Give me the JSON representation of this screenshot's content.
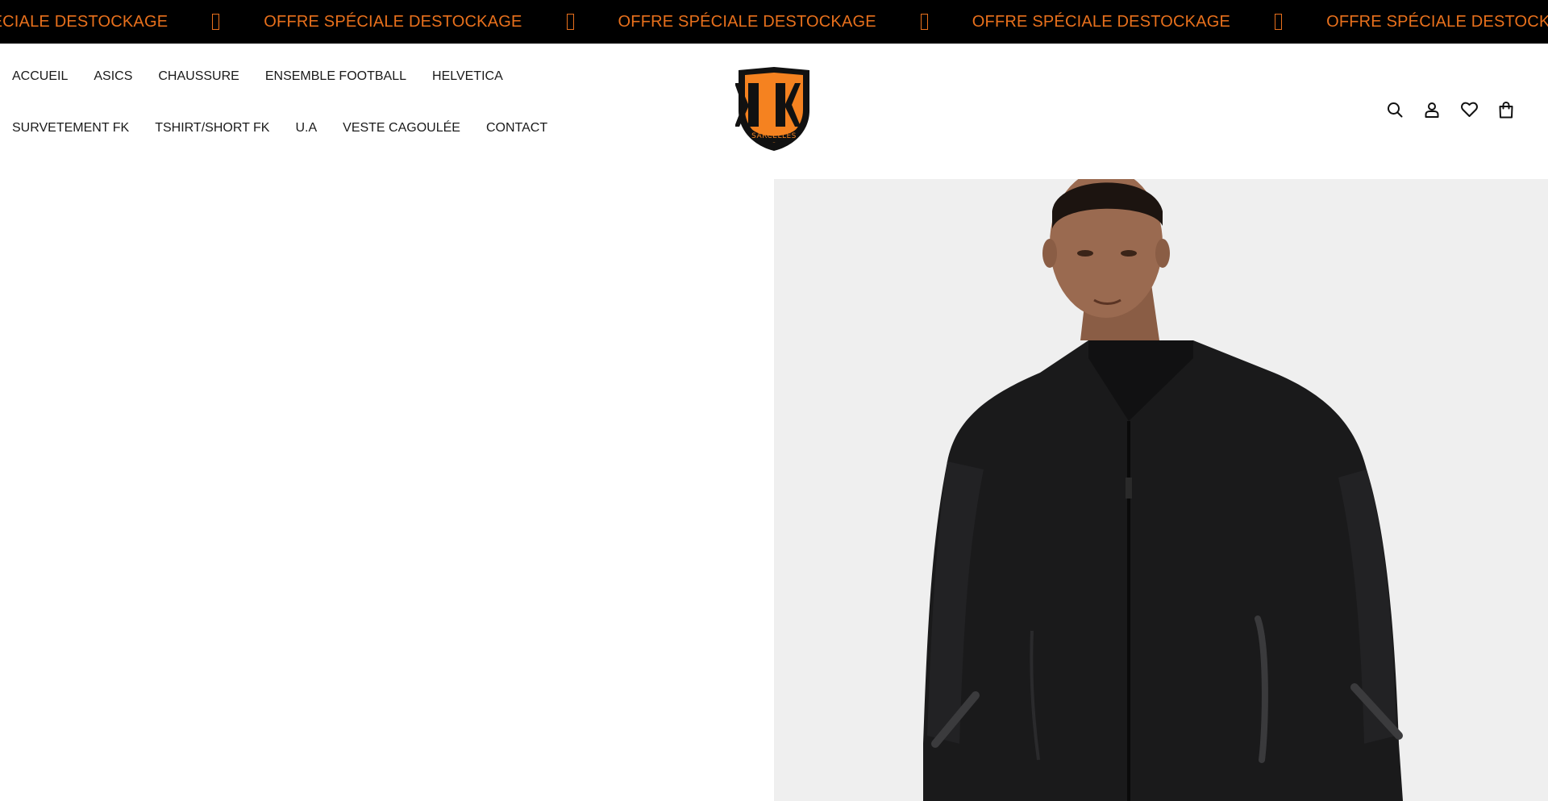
{
  "announcement": {
    "text": "OFFRE SPÉCIALE DESTOCKAGE",
    "repeat_items": [
      "OFFRE SPÉCIALE DESTOCKAGE",
      "OFFRE SPÉCIALE DESTOCKAGE",
      "OFFRE SPÉCIALE DESTOCKAGE",
      "OFFRE SPÉCIALE DESTOCKAGE",
      "OFFRE SPÉCIALE DESTOCKAGE"
    ],
    "text_color": "#e8701c",
    "background": "#000000",
    "separator_icon": "missing-glyph-box"
  },
  "header": {
    "nav": {
      "row1": [
        "ACCUEIL",
        "ASICS",
        "CHAUSSURE",
        "ENSEMBLE FOOTBALL",
        "HELVETICA"
      ],
      "row2": [
        "SURVETEMENT FK",
        "TSHIRT/SHORT FK",
        "U.A",
        "VESTE CAGOULÉE",
        "CONTACT"
      ]
    },
    "logo": {
      "letters": "KK",
      "ring_text": "SARCELLES",
      "brand_orange": "#f58220",
      "brand_black": "#111111"
    },
    "icons": [
      "search-icon",
      "account-icon",
      "wishlist-heart-icon",
      "cart-bag-icon"
    ]
  },
  "product": {
    "image_description_icon": "jacket-model-photo",
    "image_background": "#efefef"
  }
}
